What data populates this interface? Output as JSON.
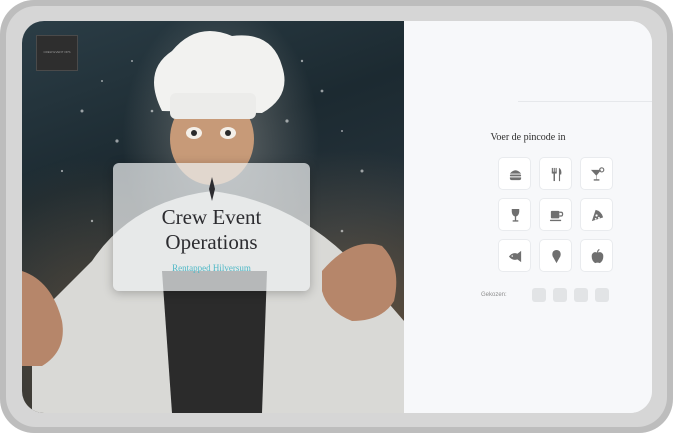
{
  "hero": {
    "logo_text": "CREW EVENT OPS",
    "title_line1": "Crew Event",
    "title_line2": "Operations",
    "subtitle": "Rentapped Hilversum"
  },
  "pin": {
    "prompt": "Voer de pincode in",
    "chosen_label": "Gekozen:",
    "slots": 4,
    "icons": [
      "burger-icon",
      "cutlery-icon",
      "cocktail-icon",
      "wine-glass-icon",
      "coffee-cup-icon",
      "pizza-icon",
      "fish-icon",
      "ice-cream-icon",
      "apple-icon"
    ],
    "icon_color": "#6f6f6f"
  },
  "colors": {
    "accent": "#4fb8c6",
    "panel_bg": "#f7f8fa",
    "slot": "#e2e4e6"
  }
}
